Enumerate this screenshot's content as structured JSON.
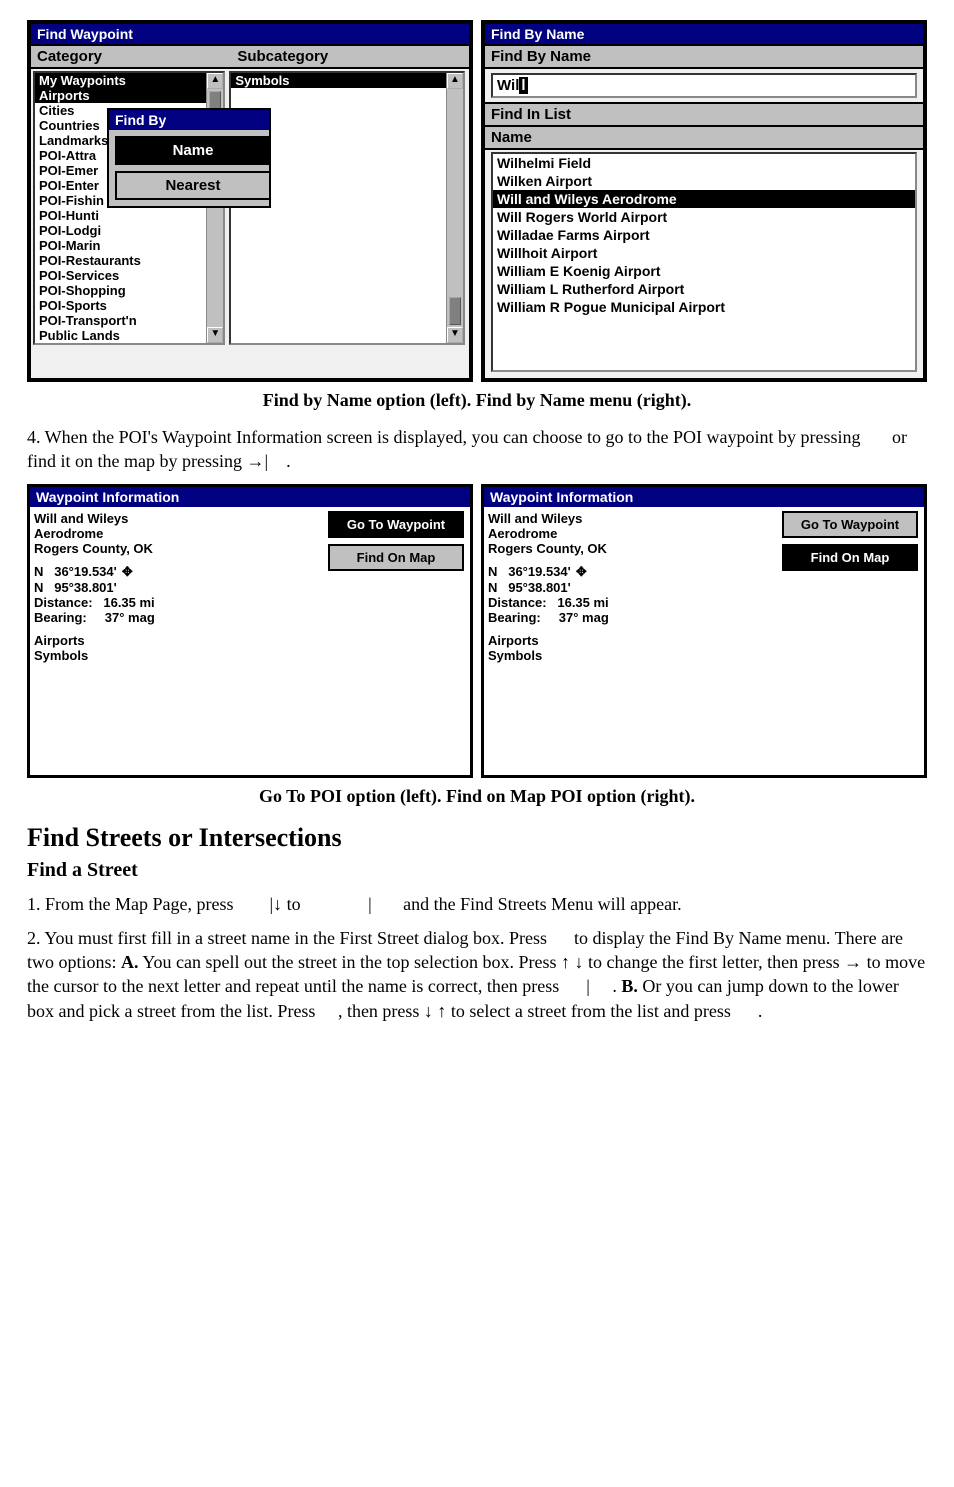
{
  "findWaypoint": {
    "title": "Find Waypoint",
    "categoryHeader": "Category",
    "subcategoryHeader": "Subcategory",
    "symbolsHeader": "Symbols",
    "categories": [
      "My Waypoints",
      "Airports",
      "Cities",
      "Countries",
      "Landmarks",
      "POI-Attra",
      "POI-Emer",
      "POI-Enter",
      "POI-Fishin",
      "POI-Hunti",
      "POI-Lodgi",
      "POI-Marin",
      "POI-Restaurants",
      "POI-Services",
      "POI-Shopping",
      "POI-Sports",
      "POI-Transport'n",
      "Public Lands"
    ],
    "overlay": {
      "title": "Find By",
      "name": "Name",
      "nearest": "Nearest"
    }
  },
  "findByName": {
    "title": "Find By Name",
    "header": "Find By Name",
    "inputPrefix": "Wil",
    "inputSel": "l",
    "listHeader": "Find In List",
    "nameCol": "Name",
    "results": [
      "Wilhelmi Field",
      "Wilken Airport",
      "Will and Wileys Aerodrome",
      "Will Rogers World Airport",
      "Willadae Farms Airport",
      "Willhoit Airport",
      "William E Koenig Airport",
      "William L Rutherford Airport",
      "William R Pogue Municipal Airport"
    ],
    "highlightIndex": 2
  },
  "caption1": "Find by Name option (left). Find by Name menu (right).",
  "para4": "4. When the POI's Waypoint Information screen is displayed, you can choose to go to the POI waypoint by pressing       or find it on the map by pressing →|    .",
  "wpinfo": {
    "title": "Waypoint Information",
    "name": "Will and Wileys",
    "sub": "Aerodrome",
    "loc": "Rogers County, OK",
    "lat": "N   36°19.534'",
    "lon": "N   95°38.801'",
    "dist": "Distance:   16.35 mi",
    "bear": "Bearing:     37° mag",
    "cat": "Airports",
    "sym": "Symbols",
    "goBtn": "Go To Waypoint",
    "findBtn": "Find On Map"
  },
  "caption2": "Go To POI option (left). Find on Map POI option (right).",
  "h2": "Find Streets or Intersections",
  "h3": "Find a Street",
  "step1": "1. From the Map Page, press        |↓ to               |       and the Find Streets Menu will appear.",
  "step2a": "2. You must first fill in a street name in the First Street dialog box. Press      to display the Find By Name menu. There are two options: ",
  "step2b": "A.",
  "step2c": " You can spell out the street in the top selection box. Press ↑ ↓ to change the first letter, then press → to move the cursor to the next letter and repeat until the name is correct, then press      |     . ",
  "step2d": "B.",
  "step2e": " Or you can jump down to the lower box and pick a street from the list. Press     , then press ↓ ↑ to select a street from the list and press      ."
}
